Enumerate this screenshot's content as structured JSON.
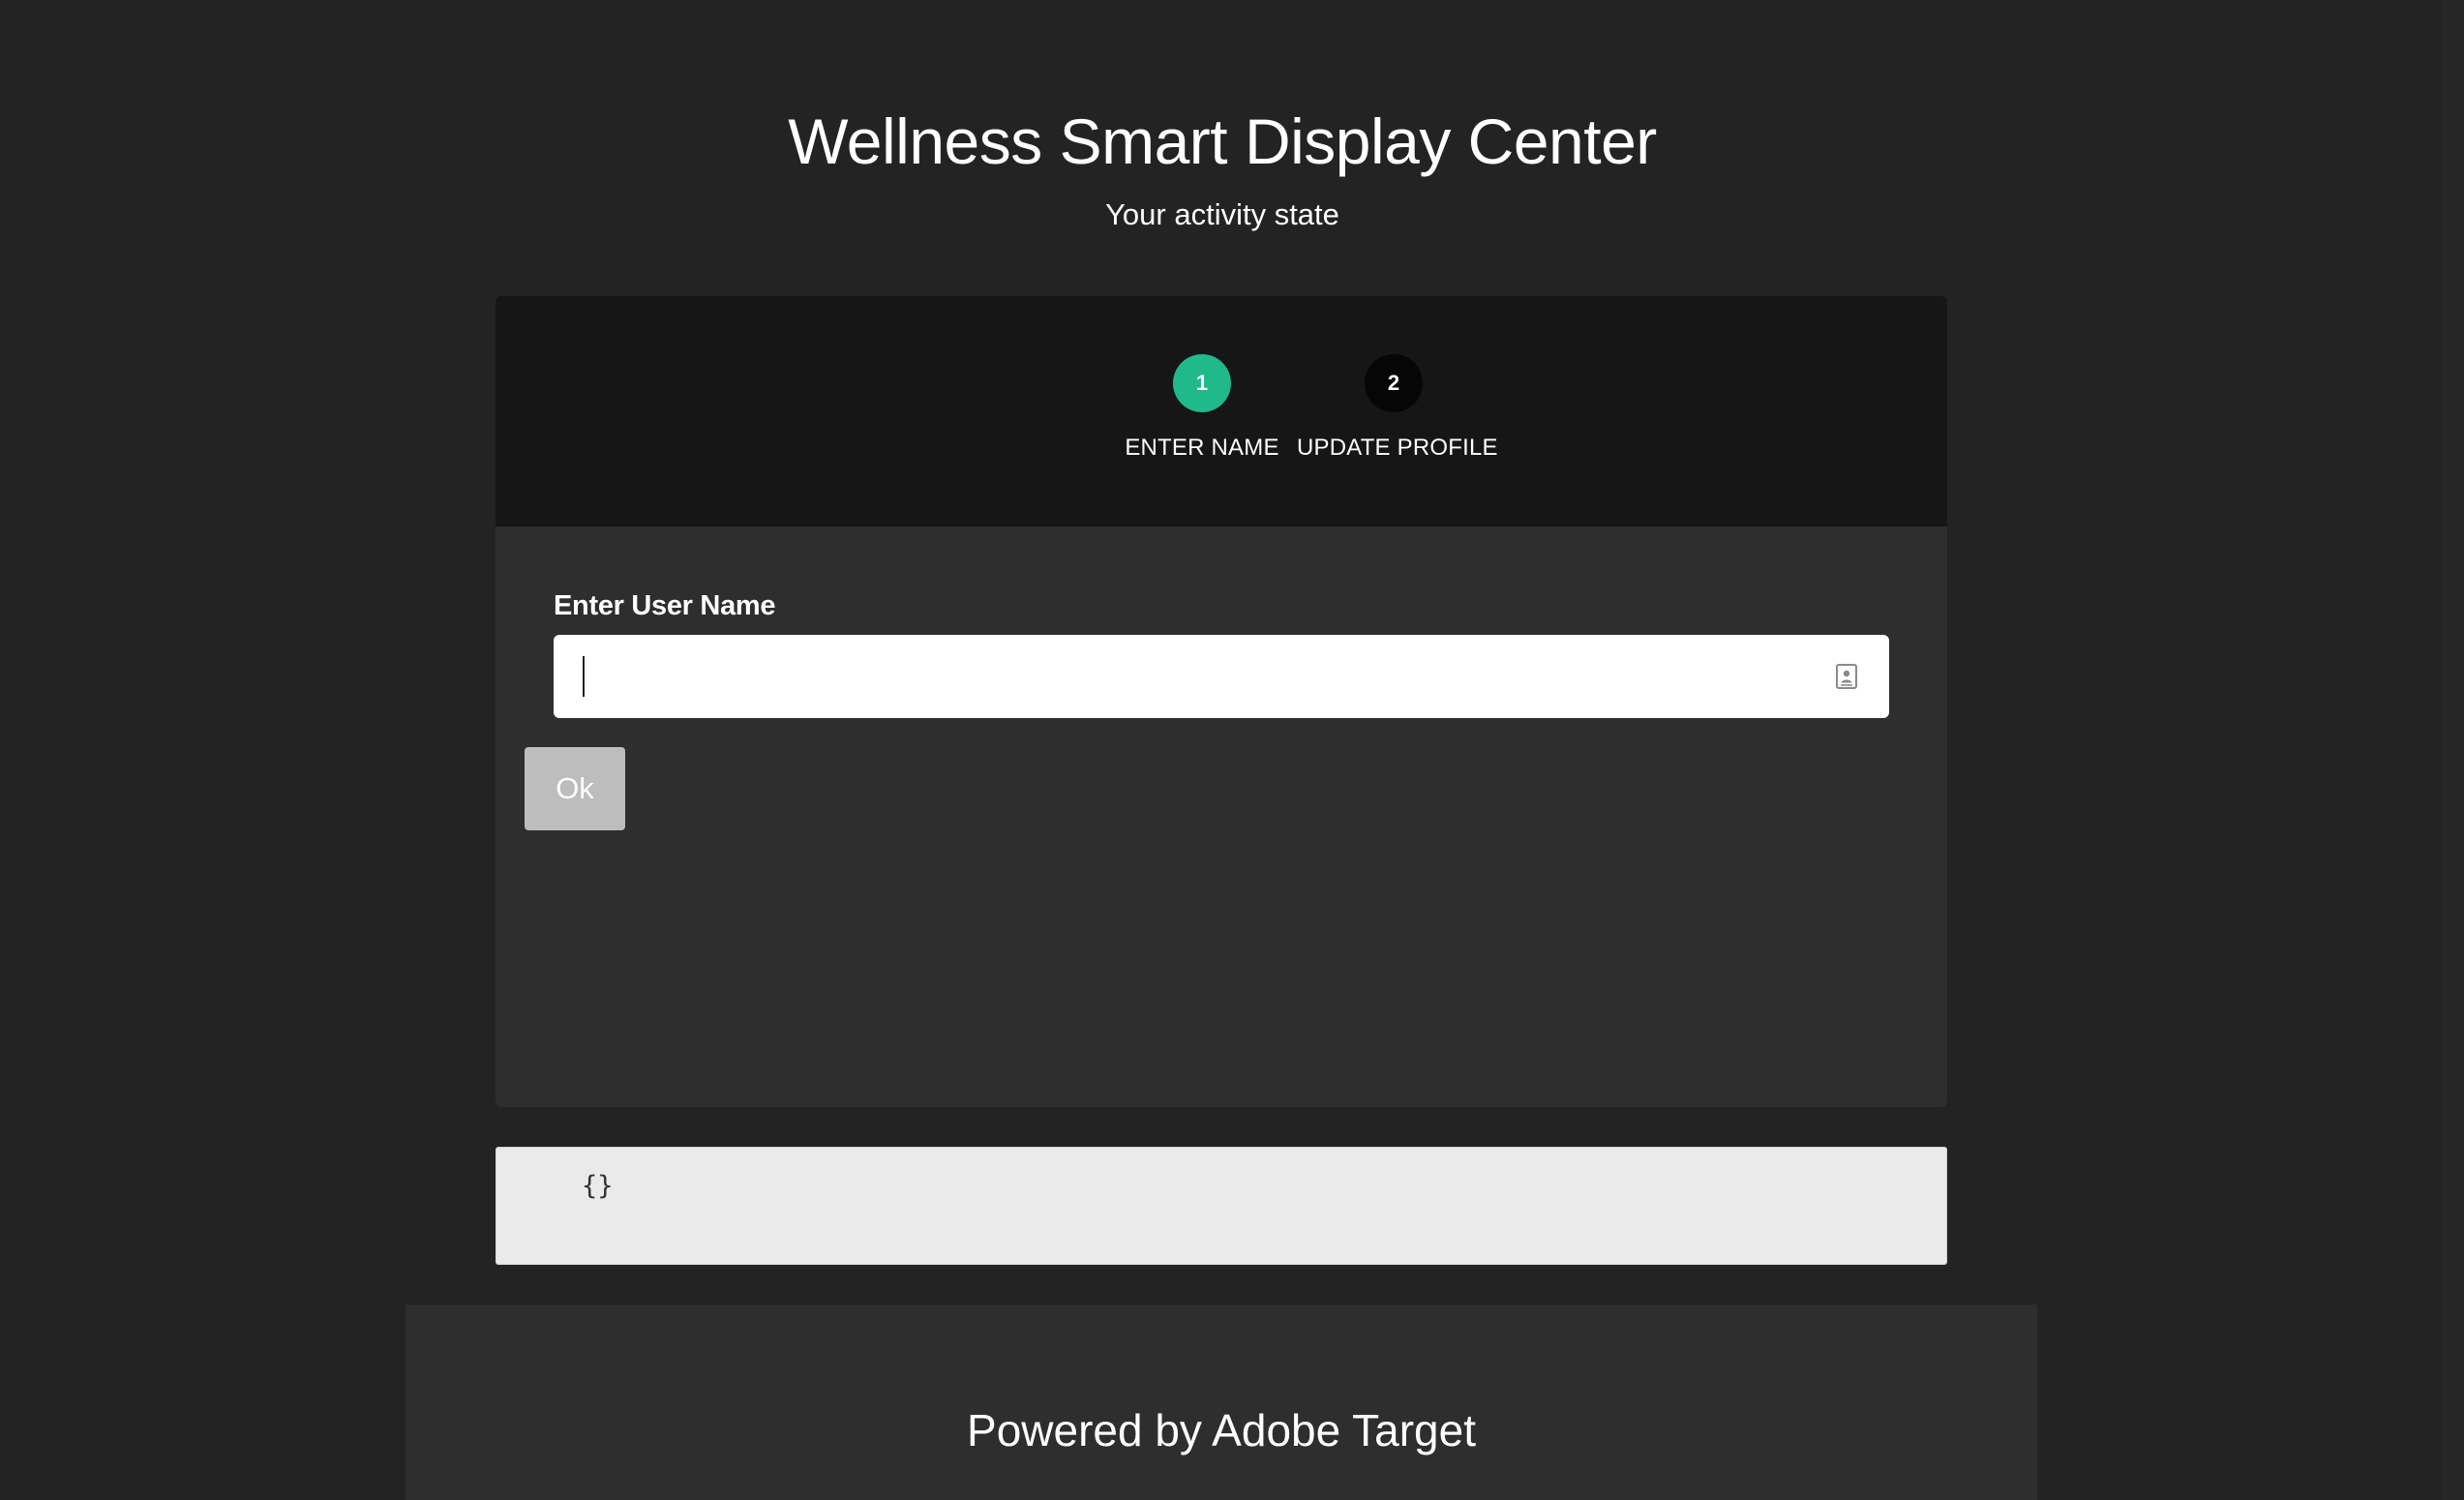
{
  "header": {
    "title": "Wellness Smart Display Center",
    "subtitle": "Your activity state"
  },
  "stepper": {
    "steps": [
      {
        "number": "1",
        "label": "ENTER NAME",
        "state": "active"
      },
      {
        "number": "2",
        "label": "UPDATE PROFILE",
        "state": "inactive"
      }
    ],
    "active_color": "#1fb98a"
  },
  "form": {
    "label": "Enter User Name",
    "input_value": "",
    "input_icon": "contact-card-icon",
    "ok_label": "Ok"
  },
  "json_output": {
    "text": "{}"
  },
  "footer": {
    "text": "Powered by Adobe Target"
  }
}
